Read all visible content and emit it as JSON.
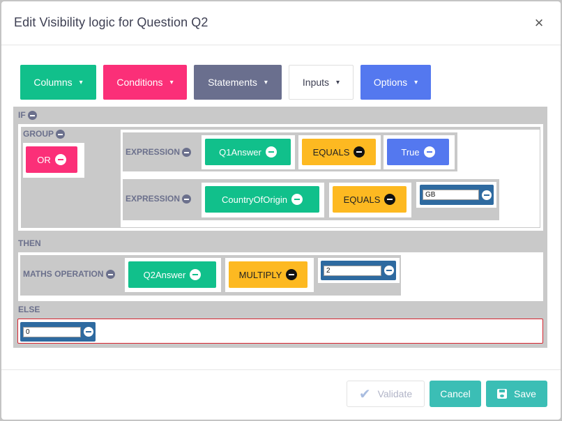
{
  "dialog": {
    "title": "Edit Visibility logic for Question Q2",
    "close_label": "×"
  },
  "toolbar": {
    "columns": "Columns",
    "conditions": "Conditions",
    "statements": "Statements",
    "inputs": "Inputs",
    "options": "Options",
    "chevron": "⌄"
  },
  "logic": {
    "if_label": "IF",
    "group_label": "GROUP",
    "or_label": "OR",
    "expr1": {
      "label": "EXPRESSION",
      "field": "Q1Answer",
      "operator": "EQUALS",
      "value": "True"
    },
    "expr2": {
      "label": "EXPRESSION",
      "field": "CountryOfOrigin",
      "operator": "EQUALS",
      "value": "GB"
    },
    "then_label": "THEN",
    "maths": {
      "label": "MATHS OPERATION",
      "field": "Q2Answer",
      "operator": "MULTIPLY",
      "value": "2"
    },
    "else_label": "ELSE",
    "else_value": "0"
  },
  "footer": {
    "validate": "Validate",
    "cancel": "Cancel",
    "save": "Save"
  },
  "colors": {
    "green": "#11c08b",
    "pink": "#fb2f78",
    "slate": "#6a6f8e",
    "blue": "#5478ef",
    "yellow": "#fdb921",
    "teal": "#3bbeb5",
    "input_blue": "#2e6aa0",
    "panel_grey": "#c9c9c9"
  }
}
